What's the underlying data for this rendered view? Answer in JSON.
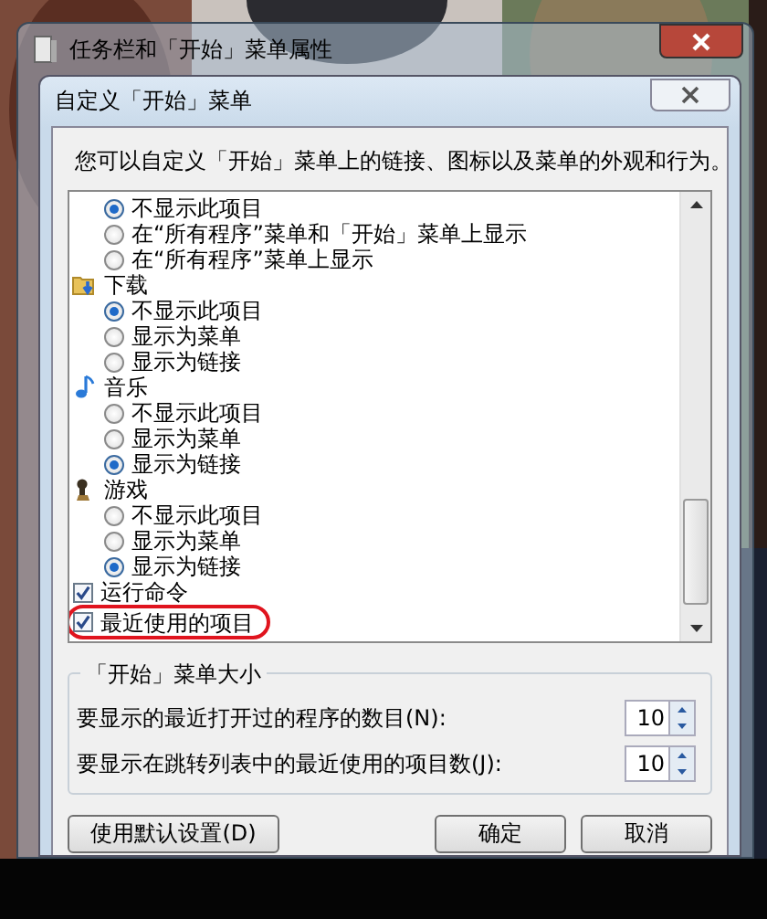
{
  "outer_window": {
    "title": "任务栏和「开始」菜单属性"
  },
  "dialog": {
    "title": "自定义「开始」菜单",
    "description": "您可以自定义「开始」菜单上的链接、图标以及菜单的外观和行为。",
    "list": [
      {
        "kind": "options",
        "options": [
          {
            "label": "不显示此项目",
            "selected": true
          },
          {
            "label": "在“所有程序”菜单和「开始」菜单上显示",
            "selected": false
          },
          {
            "label": "在“所有程序”菜单上显示",
            "selected": false
          }
        ]
      },
      {
        "kind": "heading",
        "label": "下载",
        "options": [
          {
            "label": "不显示此项目",
            "selected": true
          },
          {
            "label": "显示为菜单",
            "selected": false
          },
          {
            "label": "显示为链接",
            "selected": false
          }
        ]
      },
      {
        "kind": "heading",
        "label": "音乐",
        "options": [
          {
            "label": "不显示此项目",
            "selected": false
          },
          {
            "label": "显示为菜单",
            "selected": false
          },
          {
            "label": "显示为链接",
            "selected": true
          }
        ]
      },
      {
        "kind": "heading",
        "label": "游戏",
        "options": [
          {
            "label": "不显示此项目",
            "selected": false
          },
          {
            "label": "显示为菜单",
            "selected": false
          },
          {
            "label": "显示为链接",
            "selected": true
          }
        ]
      },
      {
        "kind": "checkbox",
        "label": "运行命令",
        "checked": true,
        "circled": false
      },
      {
        "kind": "checkbox",
        "label": "最近使用的项目",
        "checked": true,
        "circled": true
      }
    ],
    "size_group": {
      "title": "「开始」菜单大小",
      "spinners": [
        {
          "label": "要显示的最近打开过的程序的数目(N):",
          "value": "10"
        },
        {
          "label": "要显示在跳转列表中的最近使用的项目数(J):",
          "value": "10"
        }
      ]
    },
    "buttons": [
      {
        "label": "使用默认设置(D)"
      },
      {
        "label": "确定"
      },
      {
        "label": "取消"
      }
    ]
  }
}
